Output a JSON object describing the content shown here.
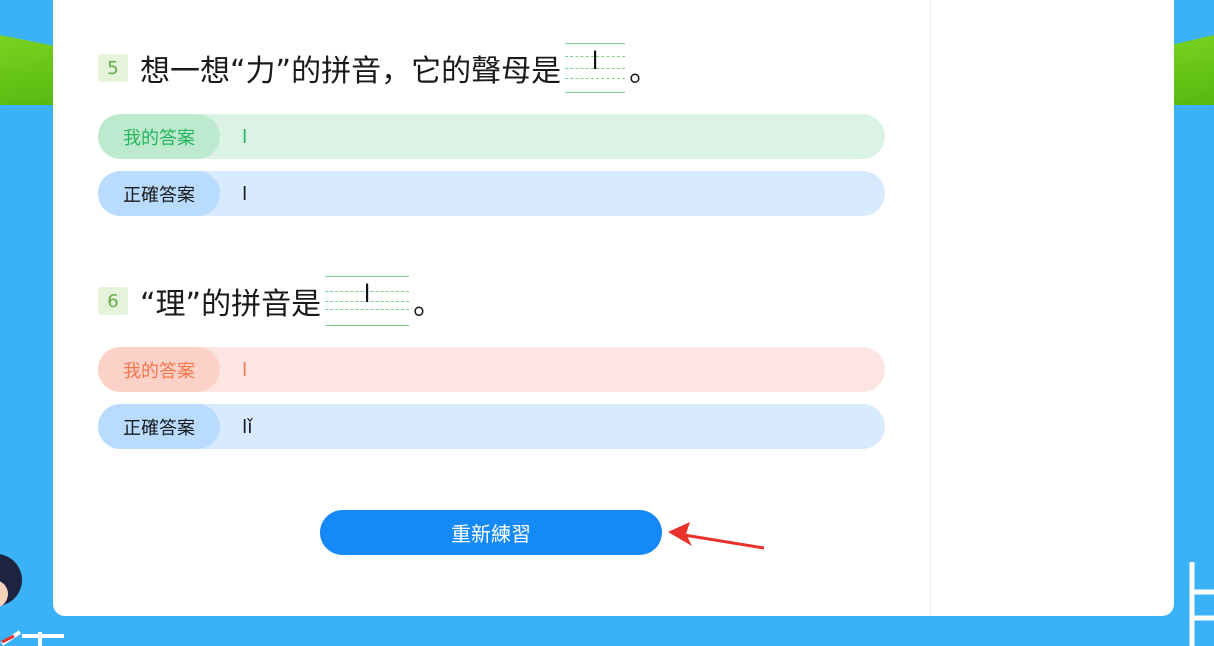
{
  "questions": [
    {
      "number": "5",
      "text_before": "想一想“力”的拼音，它的聲母是",
      "blank_value": "l",
      "text_after": "。",
      "my_answer_label": "我的答案",
      "my_answer": "l",
      "my_answer_status": "correct",
      "correct_label": "正確答案",
      "correct_answer": "l"
    },
    {
      "number": "6",
      "text_before": "“理”的拼音是",
      "blank_value": "l",
      "text_after": "。",
      "my_answer_label": "我的答案",
      "my_answer": "l",
      "my_answer_status": "wrong",
      "correct_label": "正確答案",
      "correct_answer": "lǐ"
    }
  ],
  "retry_button_label": "重新練習",
  "colors": {
    "background": "#3bb2f7",
    "correct_green": "#27b45e",
    "wrong_red": "#f4764f",
    "button_blue": "#1589f5",
    "arrow_red": "#e8322b"
  }
}
